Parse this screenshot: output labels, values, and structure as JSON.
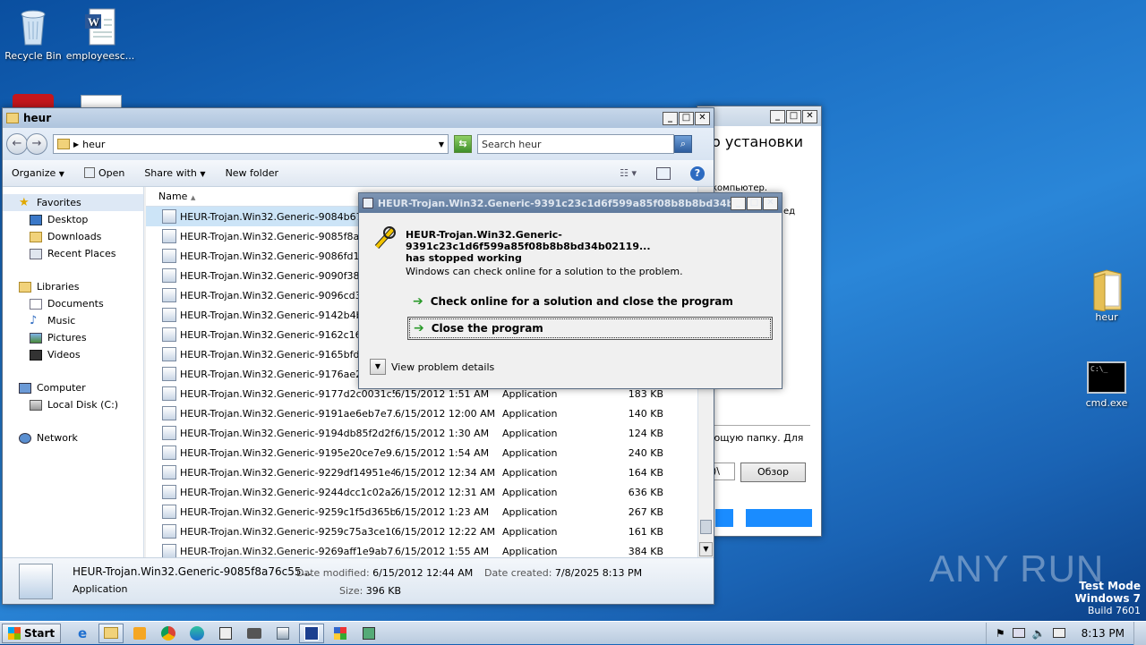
{
  "desktop": {
    "icons": [
      {
        "label": "Recycle Bin"
      },
      {
        "label": "employeesc..."
      },
      {
        "label": "heur"
      },
      {
        "label": "cmd.exe"
      }
    ],
    "watermark": {
      "brand": "ANY RUN",
      "test_mode": "Test Mode",
      "os": "Windows 7",
      "build": "Build 7601"
    }
  },
  "background_installer": {
    "title_fragment": "о установки",
    "text_1": "компьютер.",
    "text_2": "ед",
    "text_3": "ющую папку. Для",
    "browse_button": "Обзор",
    "path_fragment": ")\\"
  },
  "explorer": {
    "title": "heur",
    "address": "heur",
    "search_placeholder": "Search heur",
    "toolbar": {
      "organize": "Organize",
      "open": "Open",
      "share_with": "Share with",
      "new_folder": "New folder"
    },
    "nav": {
      "favorites": "Favorites",
      "favorites_items": [
        "Desktop",
        "Downloads",
        "Recent Places"
      ],
      "libraries": "Libraries",
      "libraries_items": [
        "Documents",
        "Music",
        "Pictures",
        "Videos"
      ],
      "computer": "Computer",
      "computer_items": [
        "Local Disk (C:)"
      ],
      "network": "Network"
    },
    "column_name": "Name",
    "files": [
      {
        "name": "HEUR-Trojan.Win32.Generic-9084b67f13",
        "date": "",
        "type": "",
        "size": ""
      },
      {
        "name": "HEUR-Trojan.Win32.Generic-9085f8a76c5",
        "date": "",
        "type": "",
        "size": ""
      },
      {
        "name": "HEUR-Trojan.Win32.Generic-9086fd10fdd",
        "date": "",
        "type": "",
        "size": ""
      },
      {
        "name": "HEUR-Trojan.Win32.Generic-9090f383d7",
        "date": "",
        "type": "",
        "size": ""
      },
      {
        "name": "HEUR-Trojan.Win32.Generic-9096cd34c8",
        "date": "",
        "type": "",
        "size": ""
      },
      {
        "name": "HEUR-Trojan.Win32.Generic-9142b4b928",
        "date": "",
        "type": "",
        "size": ""
      },
      {
        "name": "HEUR-Trojan.Win32.Generic-9162c1643a",
        "date": "",
        "type": "",
        "size": ""
      },
      {
        "name": "HEUR-Trojan.Win32.Generic-9165bfd840",
        "date": "",
        "type": "",
        "size": ""
      },
      {
        "name": "HEUR-Trojan.Win32.Generic-9176ae2b28",
        "date": "",
        "type": "",
        "size": ""
      },
      {
        "name": "HEUR-Trojan.Win32.Generic-9177d2c0031c5...",
        "date": "6/15/2012 1:51 AM",
        "type": "Application",
        "size": "183 KB"
      },
      {
        "name": "HEUR-Trojan.Win32.Generic-9191ae6eb7e7...",
        "date": "6/15/2012 12:00 AM",
        "type": "Application",
        "size": "140 KB"
      },
      {
        "name": "HEUR-Trojan.Win32.Generic-9194db85f2d2f...",
        "date": "6/15/2012 1:30 AM",
        "type": "Application",
        "size": "124 KB"
      },
      {
        "name": "HEUR-Trojan.Win32.Generic-9195e20ce7e9...",
        "date": "6/15/2012 1:54 AM",
        "type": "Application",
        "size": "240 KB"
      },
      {
        "name": "HEUR-Trojan.Win32.Generic-9229df14951e4...",
        "date": "6/15/2012 12:34 AM",
        "type": "Application",
        "size": "164 KB"
      },
      {
        "name": "HEUR-Trojan.Win32.Generic-9244dcc1c02a2...",
        "date": "6/15/2012 12:31 AM",
        "type": "Application",
        "size": "636 KB"
      },
      {
        "name": "HEUR-Trojan.Win32.Generic-9259c1f5d365b...",
        "date": "6/15/2012 1:23 AM",
        "type": "Application",
        "size": "267 KB"
      },
      {
        "name": "HEUR-Trojan.Win32.Generic-9259c75a3ce10...",
        "date": "6/15/2012 12:22 AM",
        "type": "Application",
        "size": "161 KB"
      },
      {
        "name": "HEUR-Trojan.Win32.Generic-9269aff1e9ab7...",
        "date": "6/15/2012 1:55 AM",
        "type": "Application",
        "size": "384 KB"
      }
    ],
    "details": {
      "name": "HEUR-Trojan.Win32.Generic-9085f8a76c55...",
      "date_modified_label": "Date modified:",
      "date_modified": "6/15/2012 12:44 AM",
      "date_created_label": "Date created:",
      "date_created": "7/8/2025 8:13 PM",
      "type": "Application",
      "size_label": "Size:",
      "size": "396 KB"
    }
  },
  "error_dialog": {
    "title": "HEUR-Trojan.Win32.Generic-9391c23c1d6f599a85f08b8b8bd34b021...",
    "program": "HEUR-Trojan.Win32.Generic-9391c23c1d6f599a85f08b8b8bd34b02119...",
    "stopped": "has stopped working",
    "info": "Windows can check online for a solution to the problem.",
    "option_check": "Check online for a solution and close the program",
    "option_close": "Close the program",
    "details": "View problem details"
  },
  "taskbar": {
    "start": "Start",
    "clock": "8:13 PM"
  }
}
